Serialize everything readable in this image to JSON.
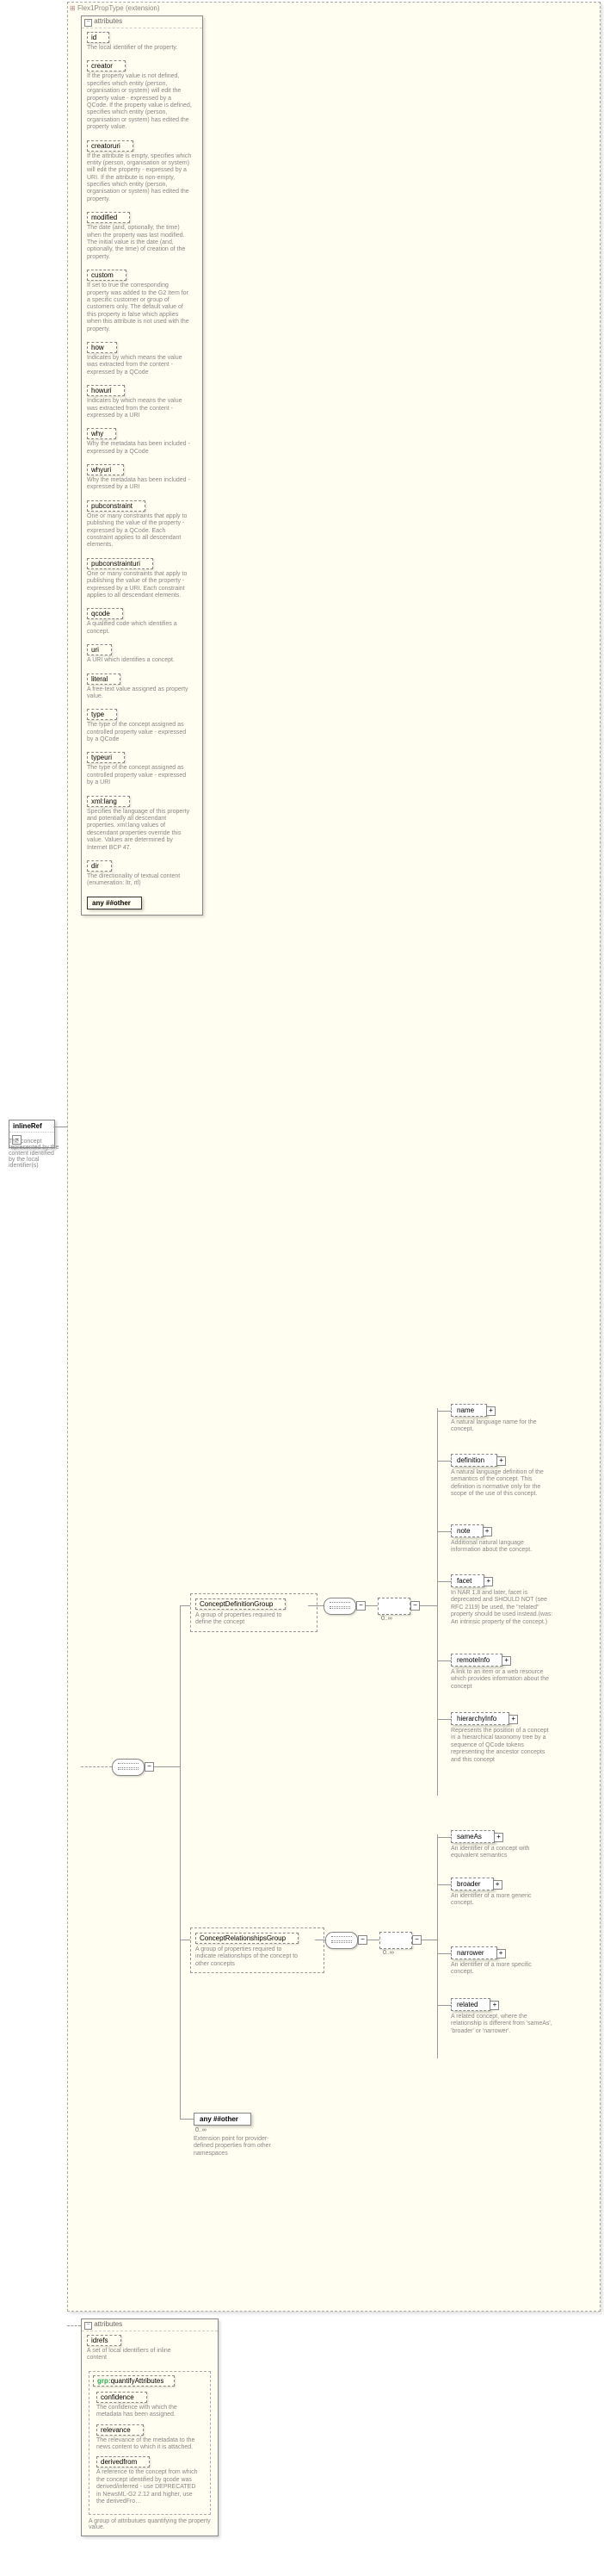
{
  "root": {
    "name": "inlineRef",
    "desc": "The concept represented by the content identified by the local identifier(s)"
  },
  "extension": {
    "label": "Flex1PropType (extension)"
  },
  "attributes_label": "attributes",
  "attrs": [
    {
      "name": "id",
      "desc": "The local identifier of the property."
    },
    {
      "name": "creator",
      "desc": "If the property value is not defined, specifies which entity (person, organisation or system) will edit the property value - expressed by a QCode. If the property value is defined, specifies which entity (person, organisation or system) has edited the property value."
    },
    {
      "name": "creatoruri",
      "desc": "If the attribute is empty, specifies which entity (person, organisation or system) will edit the property - expressed by a URI. If the attribute is non-empty, specifies which entity (person, organisation or system) has edited the property."
    },
    {
      "name": "modified",
      "desc": "The date (and, optionally, the time) when the property was last modified. The initial value is the date (and, optionally, the time) of creation of the property."
    },
    {
      "name": "custom",
      "desc": "If set to true the corresponding property was added to the G2 Item for a specific customer or group of customers only. The default value of this property is false which applies when this attribute is not used with the property."
    },
    {
      "name": "how",
      "desc": "Indicates by which means the value was extracted from the content - expressed by a QCode"
    },
    {
      "name": "howuri",
      "desc": "Indicates by which means the value was extracted from the content - expressed by a URI"
    },
    {
      "name": "why",
      "desc": "Why the metadata has been included - expressed by a QCode"
    },
    {
      "name": "whyuri",
      "desc": "Why the metadata has been included - expressed by a URI"
    },
    {
      "name": "pubconstraint",
      "desc": "One or many constraints that apply to publishing the value of the property - expressed by a QCode. Each constraint applies to all descendant elements."
    },
    {
      "name": "pubconstrainturi",
      "desc": "One or many constraints that apply to publishing the value of the property - expressed by a URI. Each constraint applies to all descendant elements."
    },
    {
      "name": "qcode",
      "desc": "A qualified code which identifies a concept."
    },
    {
      "name": "uri",
      "desc": "A URI which identifies a concept."
    },
    {
      "name": "literal",
      "desc": "A free-text value assigned as property value."
    },
    {
      "name": "type",
      "desc": "The type of the concept assigned as controlled property value - expressed by a QCode"
    },
    {
      "name": "typeuri",
      "desc": "The type of the concept assigned as controlled property value - expressed by a URI"
    },
    {
      "name": "xml:lang",
      "desc": "Specifies the language of this property and potentially all descendant properties. xml:lang values of descendant properties override this value. Values are determined by Internet BCP 47."
    },
    {
      "name": "dir",
      "desc": "The directionality of textual content (enumeration: ltr, rtl)"
    }
  ],
  "attr_any": "any ##other",
  "seq_occur": "0..∞",
  "choice_occur": "0..∞",
  "groups": {
    "def": {
      "name": "ConceptDefinitionGroup",
      "desc": "A group of properties required to define the concept"
    },
    "rel": {
      "name": "ConceptRelationshipsGroup",
      "desc": "A group of properties required to indicate relationships of the concept to other concepts"
    }
  },
  "def_elems": [
    {
      "name": "name",
      "desc": "A natural language name for the concept."
    },
    {
      "name": "definition",
      "desc": "A natural language definition of the semantics of the concept. This definition is normative only for the scope of the use of this concept."
    },
    {
      "name": "note",
      "desc": "Additional natural language information about the concept."
    },
    {
      "name": "facet",
      "desc": "In NAR 1.8 and later, facet is deprecated and SHOULD NOT (see RFC 2119) be used, the \"related\" property should be used instead.(was: An intrinsic property of the concept.)"
    },
    {
      "name": "remoteInfo",
      "desc": "A link to an item or a web resource which provides information about the concept"
    },
    {
      "name": "hierarchyInfo",
      "desc": "Represents the position of a concept in a hierarchical taxonomy tree by a sequence of QCode tokens representing the ancestor concepts and this concept"
    }
  ],
  "rel_elems": [
    {
      "name": "sameAs",
      "desc": "An identifier of a concept with equivalent semantics"
    },
    {
      "name": "broader",
      "desc": "An identifier of a more generic concept."
    },
    {
      "name": "narrower",
      "desc": "An identifier of a more specific concept."
    },
    {
      "name": "related",
      "desc": "A related concept, where the relationship is different from 'sameAs', 'broader' or 'narrower'."
    }
  ],
  "any_elem": {
    "name": "any ##other",
    "desc": "Extension point for provider-defined properties from other namespaces"
  },
  "bottom": {
    "panel_label": "attributes",
    "idrefs": {
      "name": "idrefs",
      "desc": "A set of local identifiers of inline content"
    },
    "group_prefix": "grp:",
    "group_name": "quantifyAttributes",
    "items": [
      {
        "name": "confidence",
        "desc": "The confidence with which the metadata has been assigned."
      },
      {
        "name": "relevance",
        "desc": "The relevance of the metadata to the news content to which it is attached."
      },
      {
        "name": "derivedfrom",
        "desc": "A reference to the concept from which the concept identified by qcode was derived/inferred - use DEPRECATED in NewsML-G2 2.12 and higher, use the derivedFro…"
      }
    ],
    "group_desc": "A group of attributues quantifying the property value."
  }
}
